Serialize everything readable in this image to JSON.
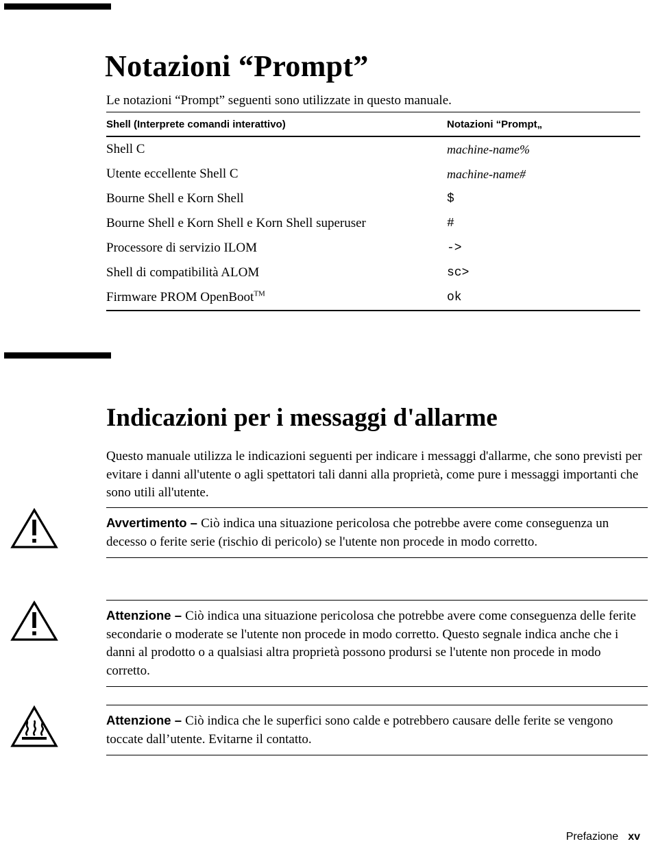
{
  "document": {
    "chapter_title": "Notazioni “Prompt”",
    "chapter_intro": "Le notazioni “Prompt” seguenti sono utilizzate in questo manuale."
  },
  "prompt_table": {
    "headers": {
      "shell": "Shell (Interprete comandi interattivo)",
      "prompt": "Notazioni “Prompt„"
    },
    "rows": [
      {
        "shell": "Shell C",
        "prompt": "machine-name%",
        "style": "italic"
      },
      {
        "shell": "Utente eccellente Shell C",
        "prompt": "machine-name#",
        "style": "italic"
      },
      {
        "shell": "Bourne Shell e Korn Shell",
        "prompt": "$",
        "style": "mono"
      },
      {
        "shell": "Bourne Shell e Korn Shell e Korn Shell superuser",
        "prompt": "#",
        "style": "mono"
      },
      {
        "shell": "Processore di servizio ILOM",
        "prompt": "->",
        "style": "mono"
      },
      {
        "shell": "Shell di compatibilità ALOM",
        "prompt": "sc>",
        "style": "mono"
      },
      {
        "shell": "Firmware PROM OpenBoot",
        "shell_superscript": "TM",
        "prompt": "ok",
        "style": "mono"
      }
    ]
  },
  "alarm_section": {
    "title": "Indicazioni per i messaggi d'allarme",
    "intro": "Questo manuale utilizza le indicazioni seguenti per indicare i messaggi d'allarme, che sono previsti per evitare i danni all'utente o agli spettatori tali danni alla proprietà, come pure i messaggi importanti che sono utili all'utente."
  },
  "admonitions": [
    {
      "icon": "warning-triangle-exclamation-icon",
      "label": "Avvertimento",
      "dash": " – ",
      "text": "Ciò indica una situazione pericolosa che potrebbe avere come conseguenza un decesso o ferite serie (rischio di pericolo) se l'utente non procede in modo corretto."
    },
    {
      "icon": "caution-triangle-exclamation-icon",
      "label": "Attenzione",
      "dash": " – ",
      "text": "Ciò indica una situazione pericolosa che potrebbe avere come conseguenza delle ferite secondarie o moderate se l'utente non procede in modo corretto. Questo segnale indica anche che i danni al prodotto o a qualsiasi altra proprietà possono prodursi se l'utente non procede in modo corretto."
    },
    {
      "icon": "hot-surface-triangle-icon",
      "label": "Attenzione",
      "dash": " – ",
      "text": "Ciò indica che le superfici sono calde e potrebbero causare delle ferite se vengono toccate dall’utente. Evitarne il contatto."
    }
  ],
  "footer": {
    "label": "Prefazione",
    "page": "xv"
  },
  "colors": {
    "text": "#000000",
    "rule": "#000000",
    "background": "#ffffff"
  }
}
